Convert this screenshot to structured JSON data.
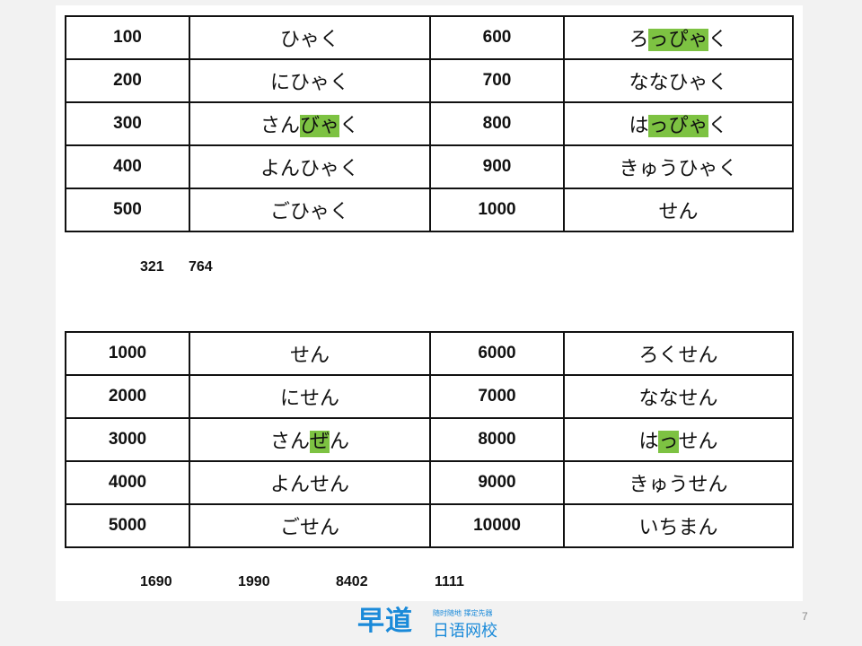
{
  "hundreds_table": [
    {
      "n1": "100",
      "r1": [
        {
          "t": "ひゃく",
          "h": false
        }
      ],
      "n2": "600",
      "r2": [
        {
          "t": "ろ",
          "h": false
        },
        {
          "t": "っぴゃ",
          "h": true
        },
        {
          "t": "く",
          "h": false
        }
      ]
    },
    {
      "n1": "200",
      "r1": [
        {
          "t": "にひゃく",
          "h": false
        }
      ],
      "n2": "700",
      "r2": [
        {
          "t": "ななひゃく",
          "h": false
        }
      ]
    },
    {
      "n1": "300",
      "r1": [
        {
          "t": "さん",
          "h": false
        },
        {
          "t": "びゃ",
          "h": true
        },
        {
          "t": "く",
          "h": false
        }
      ],
      "n2": "800",
      "r2": [
        {
          "t": "は",
          "h": false
        },
        {
          "t": "っぴゃ",
          "h": true
        },
        {
          "t": "く",
          "h": false
        }
      ]
    },
    {
      "n1": "400",
      "r1": [
        {
          "t": "よんひゃく",
          "h": false
        }
      ],
      "n2": "900",
      "r2": [
        {
          "t": "きゅうひゃく",
          "h": false
        }
      ]
    },
    {
      "n1": "500",
      "r1": [
        {
          "t": "ごひゃく",
          "h": false
        }
      ],
      "n2": "1000",
      "r2": [
        {
          "t": "せん",
          "h": false
        }
      ]
    }
  ],
  "thousands_table": [
    {
      "n1": "1000",
      "r1": [
        {
          "t": "せん",
          "h": false
        }
      ],
      "n2": "6000",
      "r2": [
        {
          "t": "ろくせん",
          "h": false
        }
      ]
    },
    {
      "n1": "2000",
      "r1": [
        {
          "t": "にせん",
          "h": false
        }
      ],
      "n2": "7000",
      "r2": [
        {
          "t": "ななせん",
          "h": false
        }
      ]
    },
    {
      "n1": "3000",
      "r1": [
        {
          "t": "さん",
          "h": false
        },
        {
          "t": "ぜ",
          "h": true
        },
        {
          "t": "ん",
          "h": false
        }
      ],
      "n2": "8000",
      "r2": [
        {
          "t": "は",
          "h": false
        },
        {
          "t": "っ",
          "h": true
        },
        {
          "t": "せん",
          "h": false
        }
      ]
    },
    {
      "n1": "4000",
      "r1": [
        {
          "t": "よんせん",
          "h": false
        }
      ],
      "n2": "9000",
      "r2": [
        {
          "t": "きゅうせん",
          "h": false
        }
      ]
    },
    {
      "n1": "5000",
      "r1": [
        {
          "t": "ごせん",
          "h": false
        }
      ],
      "n2": "10000",
      "r2": [
        {
          "t": "いちまん",
          "h": false
        }
      ]
    }
  ],
  "exercises1": [
    "321",
    "764"
  ],
  "exercises2": [
    "1690",
    "1990",
    "8402",
    "1111"
  ],
  "logo": {
    "mark": "早道",
    "tagline": "随时随地 擇定先器",
    "sub": "日语网校"
  },
  "page_number": "7",
  "colors": {
    "highlight": "#7dc242",
    "logo": "#1a8ad9"
  }
}
